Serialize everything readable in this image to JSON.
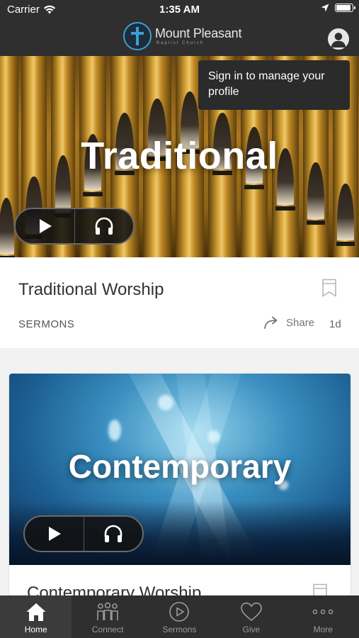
{
  "status_bar": {
    "carrier": "Carrier",
    "time": "1:35 AM",
    "battery_level": 0.9
  },
  "header": {
    "logo_name": "Mount Pleasant",
    "logo_subtitle": "Baptist Church",
    "profile_tooltip": "Sign in to manage your profile"
  },
  "feed": [
    {
      "hero_title": "Traditional",
      "title": "Traditional Worship",
      "category": "SERMONS",
      "share_label": "Share",
      "age": "1d"
    },
    {
      "hero_title": "Contemporary",
      "title": "Contemporary Worship"
    }
  ],
  "tabbar": {
    "tabs": [
      {
        "label": "Home",
        "icon": "home-icon",
        "active": true
      },
      {
        "label": "Connect",
        "icon": "people-icon",
        "active": false
      },
      {
        "label": "Sermons",
        "icon": "play-circle-icon",
        "active": false
      },
      {
        "label": "Give",
        "icon": "heart-icon",
        "active": false
      },
      {
        "label": "More",
        "icon": "more-icon",
        "active": false
      }
    ]
  },
  "colors": {
    "header_bg": "#2f2f2f",
    "logo_ring": "#3a9fd6",
    "tab_active_bg": "#3b3b3b"
  }
}
